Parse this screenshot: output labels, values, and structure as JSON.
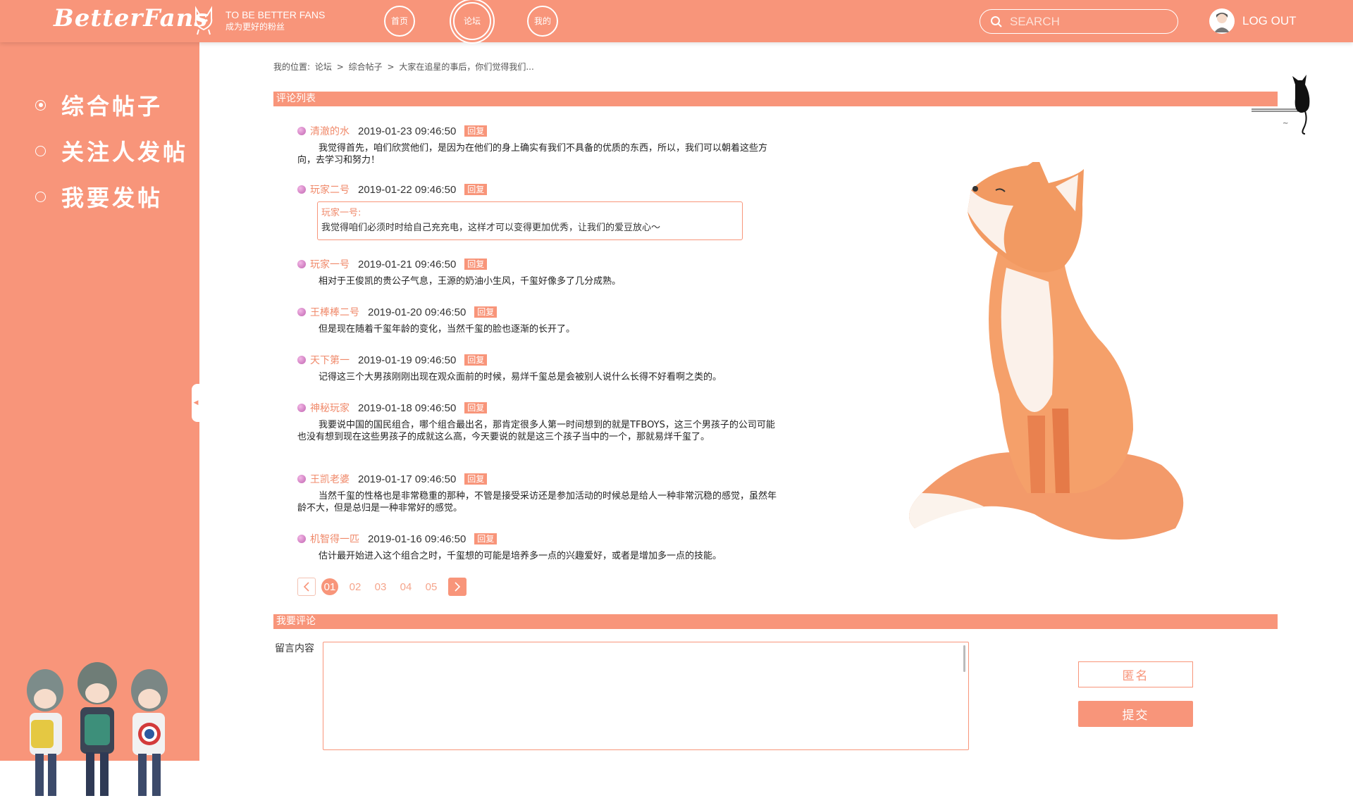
{
  "header": {
    "logo": "BetterFans",
    "tagline_en": "TO BE BETTER FANS",
    "tagline_cn": "成为更好的粉丝",
    "nav": [
      {
        "label": "首页",
        "active": false
      },
      {
        "label": "论坛",
        "active": true
      },
      {
        "label": "我的",
        "active": false
      }
    ],
    "search_placeholder": "SEARCH",
    "logout": "LOG OUT"
  },
  "sidebar": {
    "items": [
      {
        "label": "综合帖子",
        "selected": true
      },
      {
        "label": "关注人发帖",
        "selected": false
      },
      {
        "label": "我要发帖",
        "selected": false
      }
    ]
  },
  "breadcrumb": {
    "prefix": "我的位置:",
    "items": [
      "论坛",
      "综合帖子",
      "大家在追星的事后，你们觉得我们..."
    ],
    "sep": ">"
  },
  "comments_section": {
    "title": "评论列表",
    "reply_label": "回复",
    "comments": [
      {
        "user": "清澈的水",
        "time": "2019-01-23 09:46:50",
        "text": "我觉得首先，咱们欣赏他们，是因为在他们的身上确实有我们不具备的优质的东西，所以，我们可以朝着这些方向，去学习和努力！"
      },
      {
        "user": "玩家二号",
        "time": "2019-01-22 09:46:50",
        "quote_user": "玩家一号:",
        "quote_text": "我觉得咱们必须时时给自己充充电，这样才可以变得更加优秀，让我们的爱豆放心～"
      },
      {
        "user": "玩家一号",
        "time": "2019-01-21 09:46:50",
        "text": "相对于王俊凯的贵公子气息，王源的奶油小生风，千玺好像多了几分成熟。"
      },
      {
        "user": "王棒棒二号",
        "time": "2019-01-20 09:46:50",
        "text": "但是现在随着千玺年龄的变化，当然千玺的脸也逐渐的长开了。"
      },
      {
        "user": "天下第一",
        "time": "2019-01-19 09:46:50",
        "text": "记得这三个大男孩刚刚出现在观众面前的时候，易烊千玺总是会被别人说什么长得不好看啊之类的。"
      },
      {
        "user": "神秘玩家",
        "time": "2019-01-18 09:46:50",
        "text": "我要说中国的国民组合，哪个组合最出名，那肯定很多人第一时间想到的就是TFBOYS，这三个男孩子的公司可能也没有想到现在这些男孩子的成就这么高，今天要说的就是这三个孩子当中的一个，那就易烊千玺了。"
      },
      {
        "user": "王凯老婆",
        "time": "2019-01-17 09:46:50",
        "text": "当然千玺的性格也是非常稳重的那种，不管是接受采访还是参加活动的时候总是给人一种非常沉稳的感觉，虽然年龄不大，但是总归是一种非常好的感觉。"
      },
      {
        "user": "机智得一匹",
        "time": "2019-01-16 09:46:50",
        "text": "估计最开始进入这个组合之时，千玺想的可能是培养多一点的兴趣爱好，或者是增加多一点的技能。"
      }
    ]
  },
  "pagination": {
    "pages": [
      "01",
      "02",
      "03",
      "04",
      "05"
    ],
    "current": "01"
  },
  "compose": {
    "title": "我要评论",
    "label": "留言内容",
    "value": "",
    "anon_button": "匿名",
    "submit_button": "提交"
  },
  "colors": {
    "accent": "#f8957a",
    "username": "#f08a6b"
  }
}
